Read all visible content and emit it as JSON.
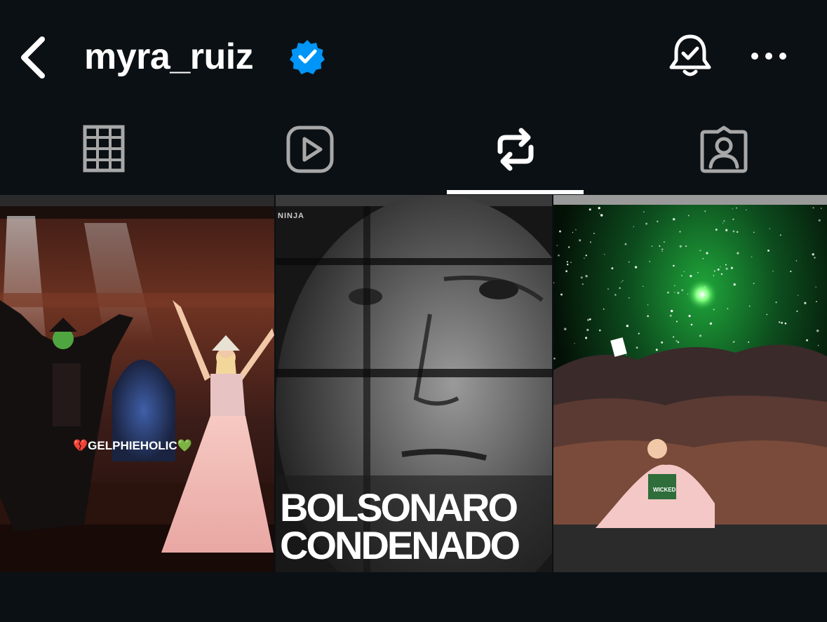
{
  "header": {
    "username": "myra_ruiz",
    "verified": true,
    "back_icon": "chevron-left-icon",
    "bell_icon": "bell-check-icon",
    "more_icon": "more-horizontal-icon"
  },
  "tabs": [
    {
      "name": "posts",
      "icon": "grid-icon",
      "active": false
    },
    {
      "name": "reels",
      "icon": "play-icon",
      "active": false
    },
    {
      "name": "reposts",
      "icon": "repost-icon",
      "active": true
    },
    {
      "name": "tagged",
      "icon": "tagged-user-icon",
      "active": false
    }
  ],
  "grid": {
    "items": [
      {
        "caption": "💔GELPHIEHOLIC💚"
      },
      {
        "watermark": "NINJA",
        "headline_line1": "BOLSONARO",
        "headline_line2": "CONDENADO"
      },
      {
        "badge": "WICKED"
      }
    ]
  },
  "colors": {
    "background": "#0b1014",
    "verified_blue": "#0095f6",
    "icon_gray": "#a8a8a8",
    "text": "#ffffff"
  }
}
